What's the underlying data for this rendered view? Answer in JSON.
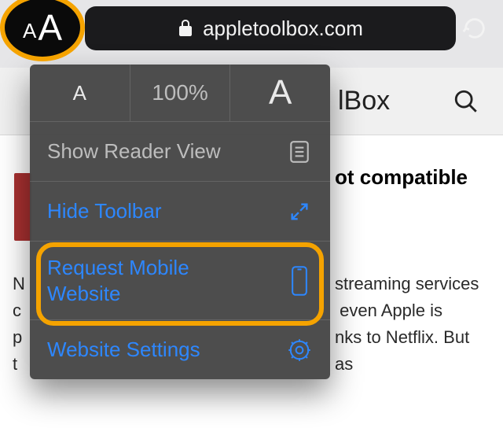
{
  "address_bar": {
    "domain": "appletoolbox.com"
  },
  "site_header": {
    "visible_title_fragment": "lBox"
  },
  "zoom": {
    "level": "100%"
  },
  "menu": {
    "reader": "Show Reader View",
    "hide_toolbar": "Hide Toolbar",
    "request_mobile": "Request Mobile Website",
    "settings": "Website Settings"
  },
  "page": {
    "headline_fragment": "ot compatible",
    "para_fragments": {
      "l1": "streaming services",
      "l2": "even Apple is",
      "l3": "nks to Netflix. But as",
      "left1": "N",
      "left2": "c",
      "left3": "p",
      "left4": "t"
    }
  },
  "colors": {
    "highlight": "#f5a300",
    "link_blue": "#2d87ff"
  }
}
